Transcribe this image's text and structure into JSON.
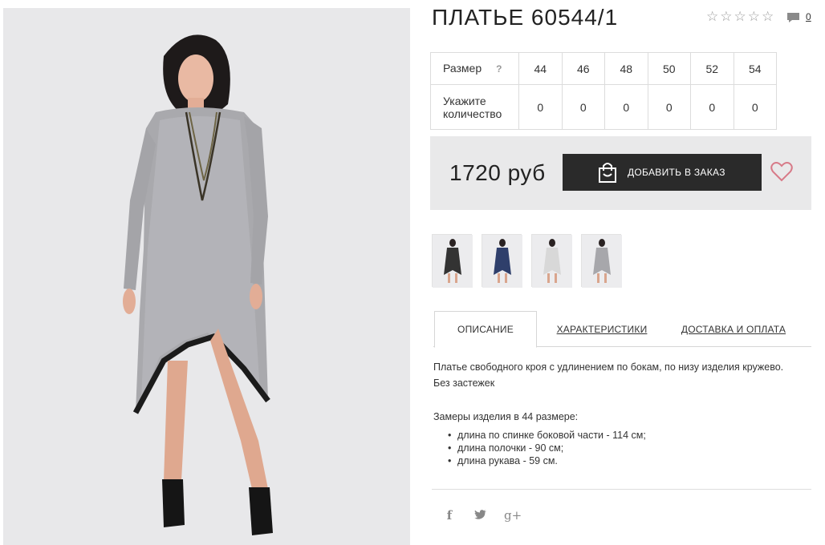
{
  "product": {
    "title": "ПЛАТЬЕ 60544/1",
    "rating_stars": [
      "☆",
      "☆",
      "☆",
      "☆",
      "☆"
    ],
    "comments_count": "0",
    "price": "1720 руб",
    "add_to_order_label": "ДОБАВИТЬ В ЗАКАЗ"
  },
  "sizes": {
    "size_label": "Размер",
    "help_icon": "?",
    "qty_label_line1": "Укажите",
    "qty_label_line2": "количество",
    "values": [
      "44",
      "46",
      "48",
      "50",
      "52",
      "54"
    ],
    "quantities": [
      "0",
      "0",
      "0",
      "0",
      "0",
      "0"
    ]
  },
  "tabs": {
    "description": "ОПИСАНИЕ",
    "characteristics": "ХАРАКТЕРИСТИКИ",
    "delivery": "ДОСТАВКА И ОПЛАТА"
  },
  "description": {
    "text_line1": "Платье свободного кроя с удлинением по бокам, по низу изделия кружево.",
    "text_line2": "Без застежек",
    "measures_title": "Замеры изделия в 44 размере:",
    "measures": [
      "длина по спинке боковой части - 114 см;",
      "длина полочки - 90 см;",
      "длина рукава - 59 см."
    ]
  },
  "social": {
    "facebook": "f",
    "twitter": "🐦",
    "googleplus": "g+"
  },
  "colors": {
    "button_bg": "#2a2a2a",
    "buy_box_bg": "#e9e9ea",
    "heart": "#d77a88"
  },
  "icons": {
    "rating": "star-icon",
    "comments": "comment-icon",
    "bag": "shopping-bag-icon",
    "favorite": "heart-icon",
    "help": "question-icon"
  }
}
